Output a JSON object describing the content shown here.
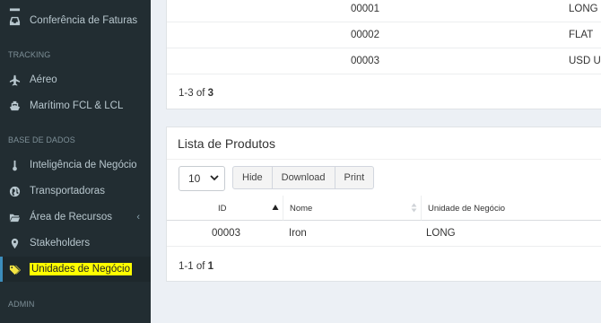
{
  "sidebar": {
    "items": [
      {
        "label": "Conferência de Faturas",
        "icon": "inbox-icon"
      },
      {
        "label": "Aéreo",
        "icon": "plane-icon"
      },
      {
        "label": "Marítimo FCL & LCL",
        "icon": "ship-icon"
      },
      {
        "label": "Inteligência de Negócio",
        "icon": "thermometer-icon"
      },
      {
        "label": "Transportadoras",
        "icon": "globe-icon"
      },
      {
        "label": "Área de Recursos",
        "icon": "folder-icon"
      },
      {
        "label": "Stakeholders",
        "icon": "map-marker-icon"
      },
      {
        "label": "Unidades de Negócio",
        "icon": "tags-icon"
      }
    ],
    "headers": {
      "tracking": "TRACKING",
      "base_dados": "BASE DE DADOS",
      "admin": "ADMIN"
    },
    "chevron": "‹"
  },
  "top_table": {
    "rows": [
      {
        "id": "00001",
        "unit": "LONG"
      },
      {
        "id": "00002",
        "unit": "FLAT"
      },
      {
        "id": "00003",
        "unit": "USD Ur"
      }
    ],
    "footer": {
      "range": "1-3",
      "of": "of",
      "total": "3"
    }
  },
  "produtos": {
    "title": "Lista de Produtos",
    "page_size": "10",
    "buttons": {
      "hide": "Hide",
      "download": "Download",
      "print": "Print"
    },
    "columns": {
      "id": "ID",
      "nome": "Nome",
      "unidade": "Unidade de Negócio"
    },
    "rows": [
      {
        "id": "00003",
        "nome": "Iron",
        "unidade": "LONG"
      }
    ],
    "footer": {
      "range": "1-1",
      "of": "of",
      "total": "1"
    }
  },
  "colors": {
    "sidebar_bg": "#222d32",
    "active_accent": "#3c8dbc",
    "highlight": "#ffff00"
  }
}
